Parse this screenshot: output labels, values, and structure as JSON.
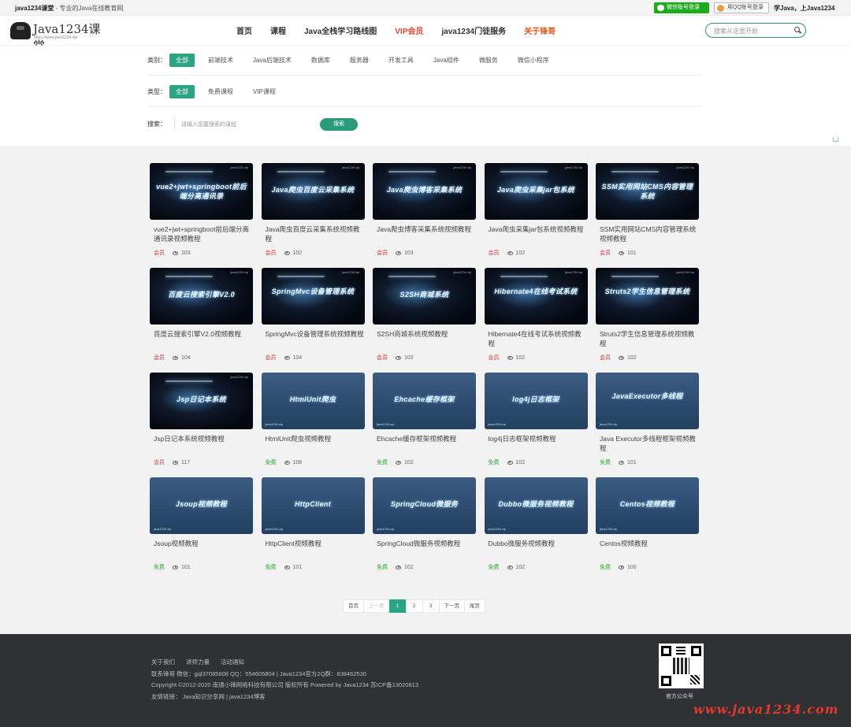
{
  "topbar": {
    "site_name": "java1234课堂",
    "site_sub": " - 专业的Java在线教育网",
    "wechat_login": "微信账号登录",
    "qq_login": "用QQ账号登录",
    "slogan": "学Java，上Java1234"
  },
  "header": {
    "logo_text": "Java1234课堂",
    "logo_url": "https://www.java1234.vip",
    "nav": [
      "首页",
      "课程",
      "Java全栈学习路线图",
      "VIP会员",
      "java1234门徒服务",
      "关于锋哥"
    ],
    "search_placeholder": "搜索从这里开始"
  },
  "filters": {
    "category_label": "类别：",
    "categories": [
      "全部",
      "前端技术",
      "Java后端技术",
      "数据库",
      "服务器",
      "开发工具",
      "Java组件",
      "微服务",
      "微信小程序"
    ],
    "type_label": "类型：",
    "types": [
      "全部",
      "免费课程",
      "VIP课程"
    ],
    "search_label": "搜索：",
    "search_placeholder": "请输入您要搜索的课程",
    "search_button": "搜索"
  },
  "courses": [
    {
      "thumb": "vue2+jwt+springboot前后端分离通讯录",
      "title": "vue2+jwt+springboot前后端分离通讯录视频教程",
      "tag": "会员",
      "views": "103",
      "style": "dark"
    },
    {
      "thumb": "Java爬虫百度云采集系统",
      "title": "Java爬虫百度云采集系统视频教程",
      "tag": "会员",
      "views": "102",
      "style": "dark"
    },
    {
      "thumb": "Java爬虫博客采集系统",
      "title": "Java爬虫博客采集系统视频教程",
      "tag": "会员",
      "views": "103",
      "style": "dark"
    },
    {
      "thumb": "Java爬虫采集jar包系统",
      "title": "Java爬虫采集jar包系统视频教程",
      "tag": "会员",
      "views": "102",
      "style": "dark"
    },
    {
      "thumb": "SSM实用网站CMS内容管理系统",
      "title": "SSM实用网站CMS内容管理系统视频教程",
      "tag": "会员",
      "views": "101",
      "style": "dark"
    },
    {
      "thumb": "百度云搜索引擎V2.0",
      "title": "百度云搜索引擎V2.0视频教程",
      "tag": "会员",
      "views": "104",
      "style": "dark"
    },
    {
      "thumb": "SpringMvc设备管理系统",
      "title": "SpringMvc设备管理系统视频教程",
      "tag": "会员",
      "views": "104",
      "style": "dark"
    },
    {
      "thumb": "S2SH商城系统",
      "title": "S2SH商城系统视频教程",
      "tag": "会员",
      "views": "102",
      "style": "dark"
    },
    {
      "thumb": "Hibernate4在线考试系统",
      "title": "Hibernate4在线考试系统视频教程",
      "tag": "会员",
      "views": "102",
      "style": "dark"
    },
    {
      "thumb": "Struts2学生信息管理系统",
      "title": "Struts2学生信息管理系统视频教程",
      "tag": "会员",
      "views": "102",
      "style": "dark"
    },
    {
      "thumb": "Jsp日记本系统",
      "title": "Jsp日记本系统视频教程",
      "tag": "会员",
      "views": "117",
      "style": "dark"
    },
    {
      "thumb": "HtmlUnit爬虫",
      "title": "HtmlUnit爬虫视频教程",
      "tag": "免费",
      "views": "106",
      "style": "blue"
    },
    {
      "thumb": "Ehcache缓存框架",
      "title": "Ehcache缓存框架视频教程",
      "tag": "免费",
      "views": "102",
      "style": "blue"
    },
    {
      "thumb": "log4j日志框架",
      "title": "log4j日志框架视频教程",
      "tag": "免费",
      "views": "102",
      "style": "blue"
    },
    {
      "thumb": "JavaExecutor多线程",
      "title": "Java Executor多线程框架视频教程",
      "tag": "免费",
      "views": "101",
      "style": "blue"
    },
    {
      "thumb": "Jsoup视频教程",
      "title": "Jsoup视频教程",
      "tag": "免费",
      "views": "101",
      "style": "blue"
    },
    {
      "thumb": "HttpClient",
      "title": "HttpClient视频教程",
      "tag": "免费",
      "views": "101",
      "style": "blue"
    },
    {
      "thumb": "SpringCloud微服务",
      "title": "SpringCloud微服务视频教程",
      "tag": "免费",
      "views": "102",
      "style": "blue"
    },
    {
      "thumb": "Dubbo微服务视频教程",
      "title": "Dubbo微服务视频教程",
      "tag": "免费",
      "views": "102",
      "style": "blue"
    },
    {
      "thumb": "Centos视频教程",
      "title": "Centos视频教程",
      "tag": "免费",
      "views": "100",
      "style": "blue"
    }
  ],
  "thumb_url": "java1234.vip",
  "pager": {
    "first": "首页",
    "prev": "上一页",
    "pages": [
      "1",
      "2",
      "3"
    ],
    "current": "1",
    "next": "下一页",
    "last": "尾页"
  },
  "footer": {
    "links": [
      "关于我们",
      "讲师力量",
      "活动通知"
    ],
    "contact": "联系锋哥 微信：gql37085608     QQ：554605804     |     Java1234官方2Q群：838462530",
    "copyright": "Copyright ©2012-2020 南通小锋网络科技有限公司 版权所有 Powered by Java1234 苏ICP备13020813",
    "friends": "友情链接：  Java知识分享网  |  java1234博客",
    "qr_label": "官方公众号",
    "watermark": "www.java1234.com"
  },
  "colors": {
    "accent": "#2aa584",
    "vip": "#dd3333",
    "free": "#33aa33",
    "footer_bg": "#2f3135"
  }
}
